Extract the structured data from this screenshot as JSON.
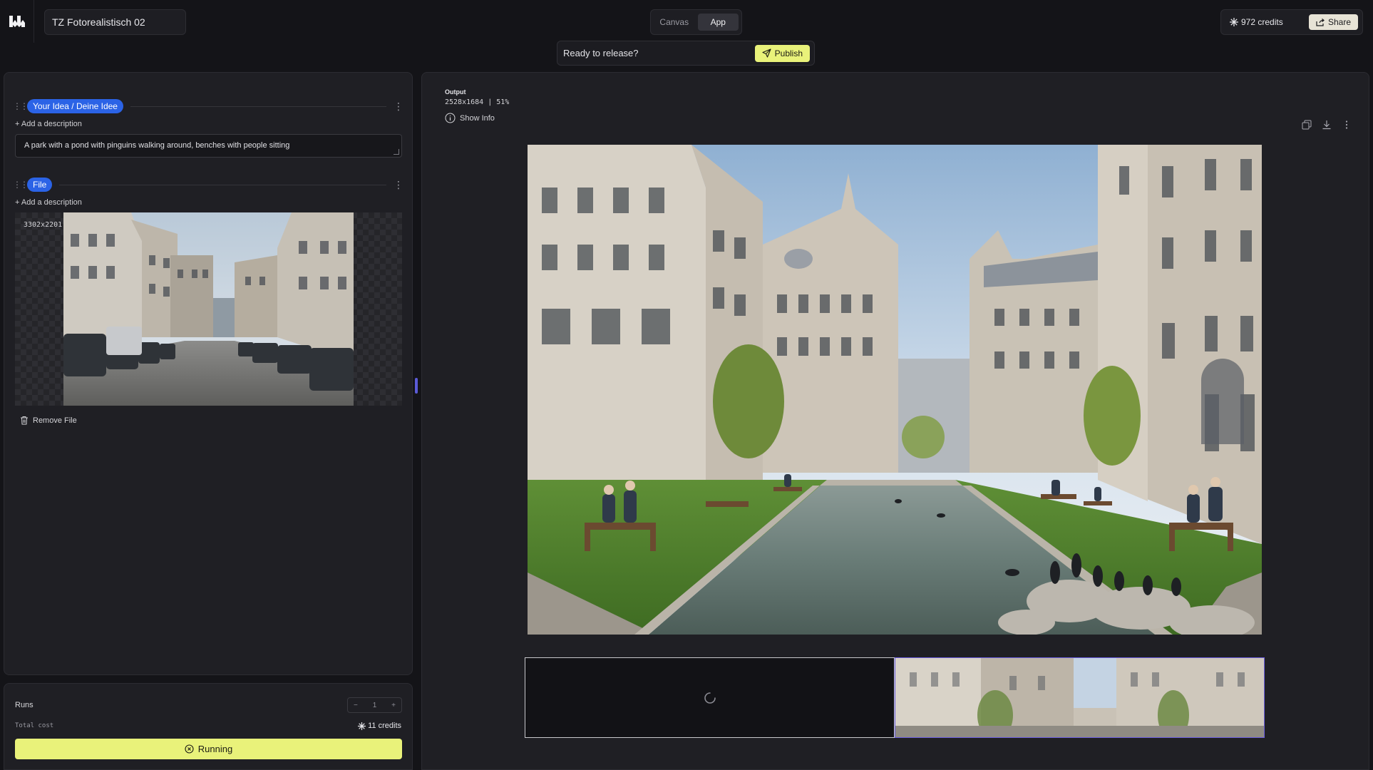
{
  "topbar": {
    "project_name": "TZ Fotorealistisch 02",
    "mode_tabs": [
      "Canvas",
      "App"
    ],
    "active_tab": "App",
    "credits": "972 credits",
    "share_label": "Share"
  },
  "release": {
    "prompt": "Ready to release?",
    "publish_label": "Publish"
  },
  "blocks": [
    {
      "label": "Your Idea / Deine Idee",
      "add_description": "+ Add a description",
      "input_value": "A park with a pond with pinguins walking around, benches with people sitting"
    },
    {
      "label": "File",
      "add_description": "+ Add a description",
      "dimensions": "3302x2201",
      "remove_label": "Remove File"
    }
  ],
  "run_panel": {
    "runs_label": "Runs",
    "runs_value": "1",
    "minus": "−",
    "plus": "+",
    "total_cost_label": "Total cost",
    "total_cost_value": "11 credits",
    "running_label": "Running"
  },
  "output": {
    "title": "Output",
    "meta": "2528x1684  |  51%",
    "show_info": "Show Info"
  },
  "colors": {
    "accent_yellow": "#e9f27a",
    "pill_blue": "#2b63e6",
    "selection_purple": "#6a5de0",
    "panel_bg": "#1f1f24",
    "page_bg": "#141418"
  }
}
